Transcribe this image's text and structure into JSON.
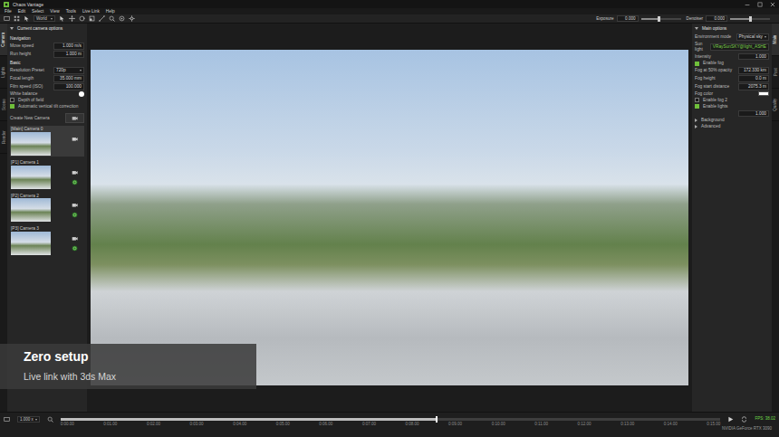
{
  "window": {
    "title": "Chaos Vantage"
  },
  "menu": [
    "File",
    "Edit",
    "Select",
    "View",
    "Tools",
    "Live Link",
    "Help"
  ],
  "toolbar": {
    "mode": "World",
    "sliders": [
      {
        "label": "Exposure",
        "value": "0.000",
        "level": 0.45
      },
      {
        "label": "Denoiser",
        "value": "0.000",
        "level": 0.5
      }
    ]
  },
  "left_tabs": [
    {
      "label": "Camera",
      "selected": true
    },
    {
      "label": "Lights",
      "selected": false
    },
    {
      "label": "Scene",
      "selected": false
    },
    {
      "label": "Render",
      "selected": false
    }
  ],
  "right_tabs": [
    {
      "label": "Main",
      "selected": true
    },
    {
      "label": "Post",
      "selected": false
    },
    {
      "label": "Quality",
      "selected": false
    }
  ],
  "camera_panel": {
    "title": "Current camera options",
    "rows": [
      {
        "kind": "heading",
        "label": "Navigation"
      },
      {
        "kind": "field",
        "label": "Move speed",
        "value": "1.000 m/s"
      },
      {
        "kind": "field",
        "label": "Run height",
        "value": "1.000 m"
      },
      {
        "kind": "heading",
        "label": "Basic"
      },
      {
        "kind": "select",
        "label": "Resolution Preset",
        "value": "720p"
      },
      {
        "kind": "field",
        "label": "Focal length",
        "value": "35.000 mm"
      },
      {
        "kind": "field",
        "label": "Film speed (ISO)",
        "value": "100.000"
      },
      {
        "kind": "toggle",
        "label": "White balance",
        "on": true
      },
      {
        "kind": "check",
        "label": "Depth of field",
        "checked": false
      },
      {
        "kind": "check",
        "label": "Automatic vertical tilt correction",
        "checked": true
      }
    ],
    "create_label": "Create New Camera",
    "cameras": [
      {
        "label": "[Main] Camera 0",
        "selected": true,
        "linked": false
      },
      {
        "label": "[P1] Camera 1",
        "selected": false,
        "linked": true
      },
      {
        "label": "[P2] Camera 2",
        "selected": false,
        "linked": true
      },
      {
        "label": "[P3] Camera 3",
        "selected": false,
        "linked": true
      }
    ]
  },
  "options_panel": {
    "title": "Main options",
    "rows": [
      {
        "kind": "select",
        "label": "Environment mode",
        "value": "Physical sky"
      },
      {
        "kind": "link",
        "label": "Sun light",
        "value": "VRaySunSKY@light_ASHE"
      },
      {
        "kind": "field",
        "label": "Intensity",
        "value": "1.000"
      },
      {
        "kind": "check",
        "label": "Enable fog",
        "checked": true
      },
      {
        "kind": "field",
        "label": "Fog at 50% opacity",
        "value": "172.330 km"
      },
      {
        "kind": "field",
        "label": "Fog height",
        "value": "0.0 m"
      },
      {
        "kind": "field",
        "label": "Fog start distance",
        "value": "2075.3 m"
      },
      {
        "kind": "color",
        "label": "Fog color",
        "color": "#ffffff"
      },
      {
        "kind": "check",
        "label": "Enable fog 2",
        "checked": false
      },
      {
        "kind": "check",
        "label": "Enable lights",
        "checked": true
      },
      {
        "kind": "field",
        "value": "1.000"
      },
      {
        "kind": "group",
        "label": "Background",
        "expanded": false
      },
      {
        "kind": "group",
        "label": "Advanced",
        "expanded": false
      }
    ]
  },
  "timeline": {
    "speed": "1.000 x",
    "level": 0.57,
    "ticks": [
      "0:00.00",
      "0:01.00",
      "0:02.00",
      "0:03.00",
      "0:04.00",
      "0:05.00",
      "0:06.00",
      "0:07.00",
      "0:08.00",
      "0:09.00",
      "0:10.00",
      "0:11.00",
      "0:12.00",
      "0:13.00",
      "0:14.00",
      "0:15.00"
    ]
  },
  "status": {
    "fps": "FPS: 38.02",
    "gpu": "NVIDIA GeForce RTX 3090"
  },
  "caption": {
    "title": "Zero setup",
    "subtitle": "Live link with 3ds Max"
  }
}
